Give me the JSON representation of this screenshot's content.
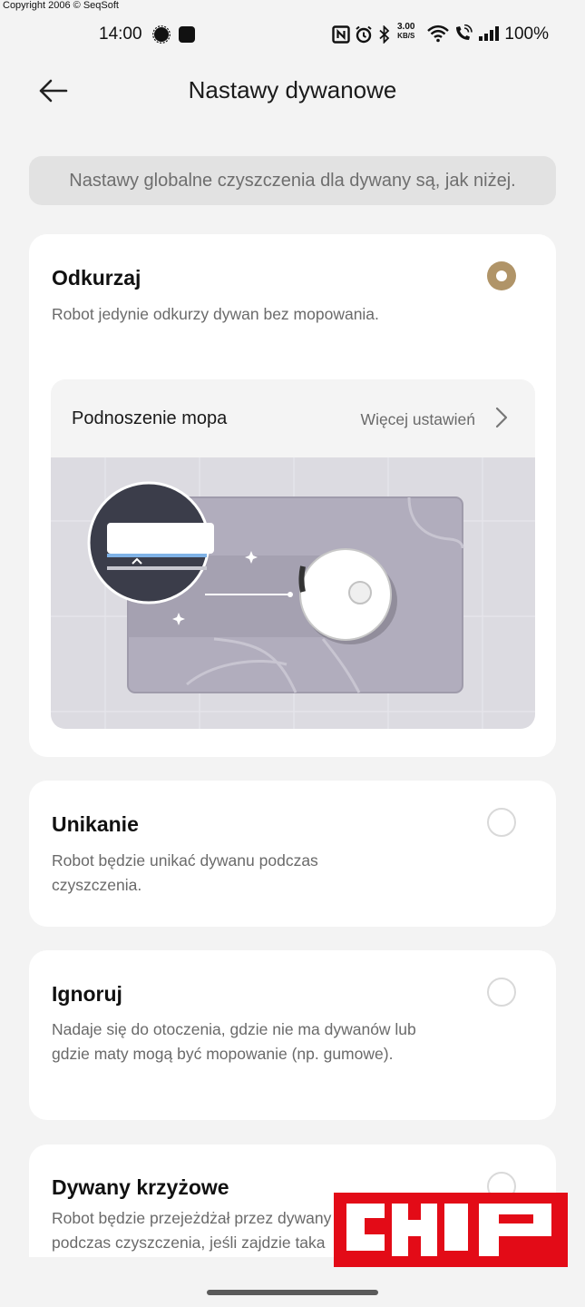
{
  "watermark": {
    "copyright": "Copyright 2006 ©  SeqSoft"
  },
  "status_bar": {
    "time": "14:00",
    "net_speed_value": "3.00",
    "net_speed_unit": "KB/S",
    "battery": "100%",
    "icons": [
      "signal-app-icon",
      "app-square-icon",
      "nfc-icon",
      "alarm-icon",
      "bluetooth-icon",
      "wifi-icon",
      "wifi-call-icon",
      "cellular-signal-icon"
    ]
  },
  "header": {
    "title": "Nastawy dywanowe",
    "back_icon": "arrow-left-icon"
  },
  "info_banner": {
    "text": "Nastawy globalne czyszczenia dla dywany są, jak niżej."
  },
  "options": [
    {
      "title": "Odkurzaj",
      "description": "Robot jedynie odkurzy dywan bez mopowania.",
      "selected": true,
      "sub_setting": {
        "label": "Podnoszenie mopa",
        "link": "Więcej ustawień"
      }
    },
    {
      "title": "Unikanie",
      "description": "Robot będzie unikać dywanu podczas czyszczenia.",
      "selected": false
    },
    {
      "title": "Ignoruj",
      "description": "Nadaje się do otoczenia, gdzie nie ma dywanów lub gdzie maty mogą być mopowanie (np. gumowe).",
      "selected": false
    },
    {
      "title": "Dywany krzyżowe",
      "description": "Robot będzie przejeżdżał przez dywany podczas czyszczenia, jeśli zajdzie taka potrzeba.",
      "selected": false
    }
  ],
  "overlay_logo": {
    "text": "CHIP"
  },
  "colors": {
    "accent": "#b09468",
    "background": "#f3f3f3",
    "card": "#ffffff",
    "logo_red": "#e30b17"
  }
}
